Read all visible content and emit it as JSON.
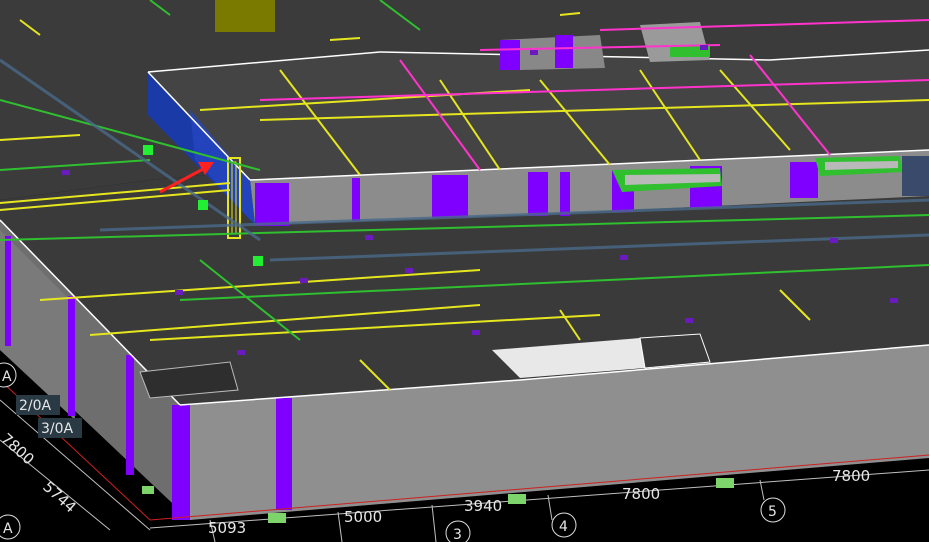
{
  "app": {
    "name": "",
    "view": ""
  },
  "dimensions": {
    "bottom": [
      "5093",
      "5000",
      "3940",
      "7800",
      "7800"
    ],
    "left": [
      "7800",
      "5744"
    ]
  },
  "grid_axes": {
    "bottom": [
      "3",
      "4",
      "5"
    ],
    "left": [
      "A",
      "2/0A",
      "3/0A",
      "A"
    ]
  },
  "colors": {
    "background": "#000000",
    "slab_top": "#3a3a3a",
    "slab_top_light": "#444444",
    "wall_side": "#8c8c8c",
    "wall_side_light": "#a8a8a8",
    "column": "#8000ff",
    "beam_yellow": "#e6e61e",
    "beam_magenta": "#ff33cc",
    "beam_green": "#2fbf2f",
    "selection_blue": "#1a3aa8",
    "pointer_red": "#ff2020",
    "grid_red": "#cc2020",
    "green_marker": "#22ee33"
  },
  "icons": {
    "arrow": "red-pointer-arrow-icon",
    "marker": "green-square-marker-icon"
  }
}
